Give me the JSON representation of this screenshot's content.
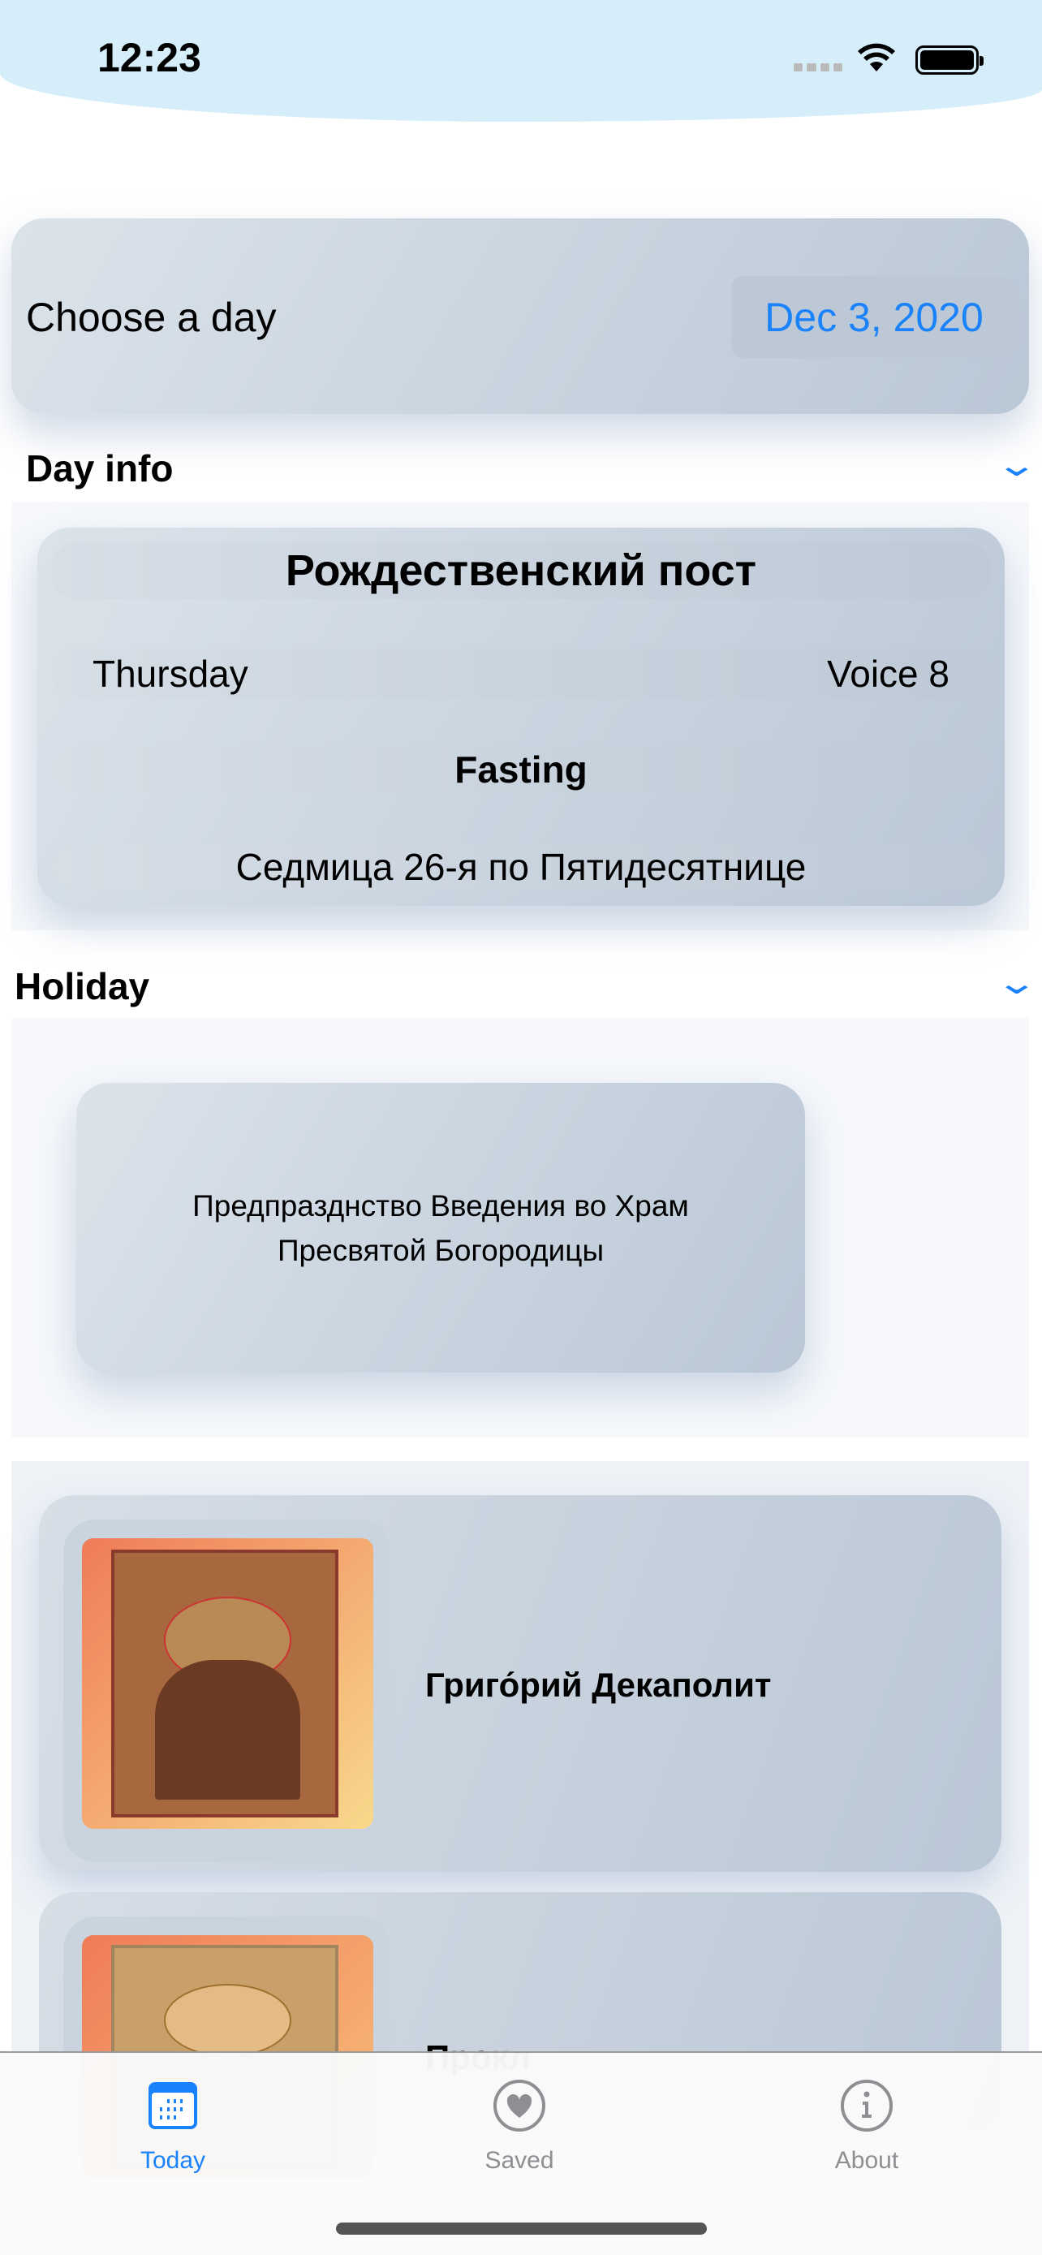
{
  "status_bar": {
    "time": "12:23"
  },
  "day_picker": {
    "label": "Choose a day",
    "date": "Dec 3, 2020"
  },
  "day_info": {
    "header": "Day info",
    "title": "Рождественский пост",
    "weekday": "Thursday",
    "voice": "Voice 8",
    "fasting": "Fasting",
    "week": "Седмица 26-я по Пятидесятнице"
  },
  "holiday": {
    "header": "Holiday",
    "lines": [
      "Предпразднство Введения во Храм",
      "Пресвятой Богородицы"
    ]
  },
  "saints": [
    {
      "name": "Григо́рий Декаполит"
    },
    {
      "name": "Прокл"
    }
  ],
  "tabs": [
    {
      "label": "Today",
      "icon": "calendar-icon",
      "active": true
    },
    {
      "label": "Saved",
      "icon": "heart-icon"
    },
    {
      "label": "About",
      "icon": "info-icon"
    }
  ],
  "colors": {
    "accent": "#1a82fb",
    "header_bg": "#d5eefa"
  }
}
